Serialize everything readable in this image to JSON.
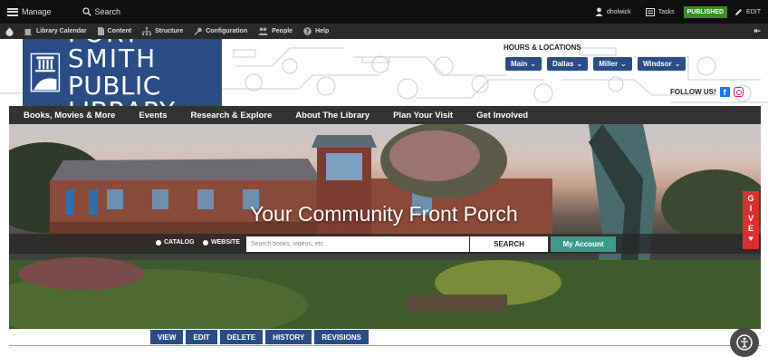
{
  "admin_bar": {
    "manage": "Manage",
    "search": "Search",
    "user": "dholwick",
    "tasks": "Tasks",
    "status": "PUBLISHED",
    "edit": "EDIT"
  },
  "toolbar": {
    "items": [
      {
        "label": "Library Calendar",
        "icon": "cup-icon"
      },
      {
        "label": "Content",
        "icon": "document-icon"
      },
      {
        "label": "Structure",
        "icon": "sitemap-icon"
      },
      {
        "label": "Configuration",
        "icon": "wrench-icon"
      },
      {
        "label": "People",
        "icon": "people-icon"
      },
      {
        "label": "Help",
        "icon": "help-icon"
      }
    ]
  },
  "logo": {
    "line1": "FORT SMITH",
    "line2": "PUBLIC LIBRARY"
  },
  "hours": {
    "label": "HOURS & LOCATIONS",
    "locations": [
      "Main",
      "Dallas",
      "Miller",
      "Windsor"
    ]
  },
  "follow": {
    "label": "FOLLOW US!"
  },
  "nav": {
    "items": [
      "Books, Movies & More",
      "Events",
      "Research & Explore",
      "About The Library",
      "Plan Your Visit",
      "Get Involved"
    ]
  },
  "hero": {
    "tagline": "Your Community Front Porch",
    "radio_catalog": "CATALOG",
    "radio_website": "WEBSITE",
    "search_placeholder": "Search books, videos, etc.",
    "search_button": "SEARCH",
    "account_button": "My Account"
  },
  "give": {
    "letters": [
      "G",
      "I",
      "V",
      "E"
    ]
  },
  "tasks": {
    "items": [
      "VIEW",
      "EDIT",
      "DELETE",
      "HISTORY",
      "REVISIONS"
    ]
  },
  "colors": {
    "brand_blue": "#2b4c85",
    "accent_teal": "#3e9a8a",
    "give_red": "#d9312f",
    "published_green": "#3b8b2a"
  }
}
